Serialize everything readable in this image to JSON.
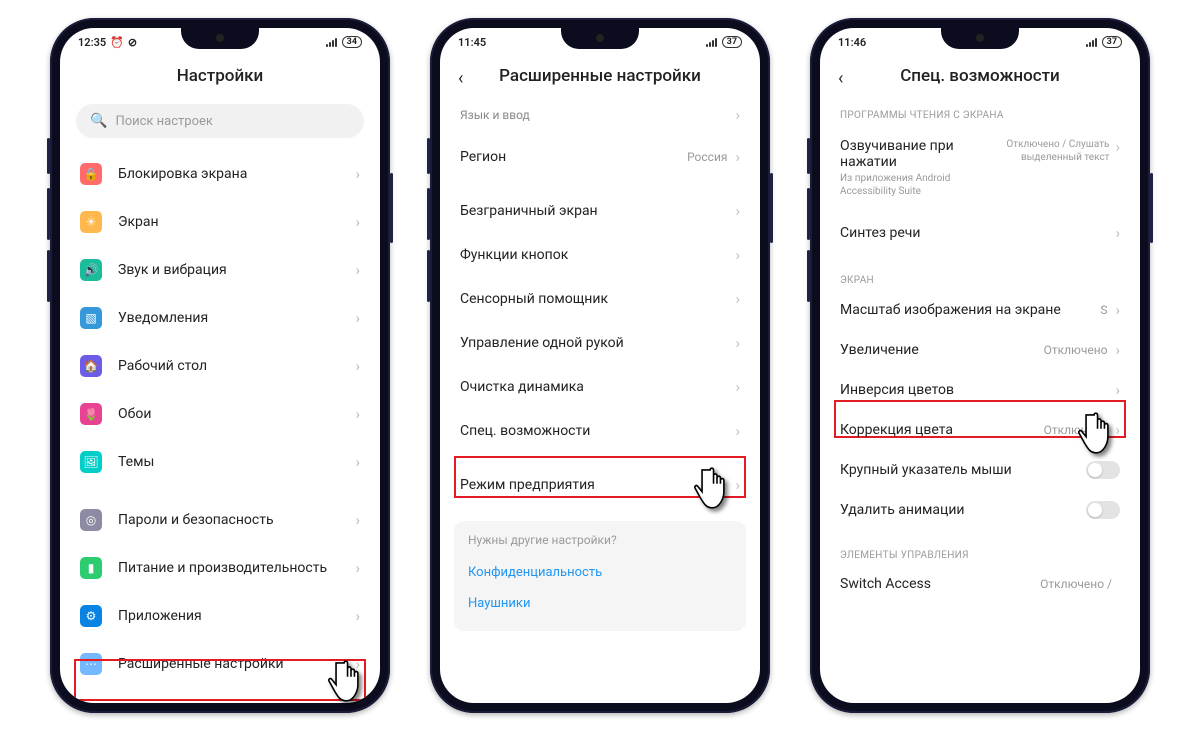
{
  "phone1": {
    "status": {
      "time": "12:35",
      "battery": "34"
    },
    "title": "Настройки",
    "search_placeholder": "Поиск настроек",
    "rows": [
      {
        "label": "Блокировка экрана"
      },
      {
        "label": "Экран"
      },
      {
        "label": "Звук и вибрация"
      },
      {
        "label": "Уведомления"
      },
      {
        "label": "Рабочий стол"
      },
      {
        "label": "Обои"
      },
      {
        "label": "Темы"
      }
    ],
    "rows2": [
      {
        "label": "Пароли и безопасность"
      },
      {
        "label": "Питание и производительность"
      },
      {
        "label": "Приложения"
      },
      {
        "label": "Расширенные настройки"
      }
    ]
  },
  "phone2": {
    "status": {
      "time": "11:45",
      "battery": "37"
    },
    "title": "Расширенные настройки",
    "top_row": "Язык и ввод",
    "region_label": "Регион",
    "region_value": "Россия",
    "rows": [
      "Безграничный экран",
      "Функции кнопок",
      "Сенсорный помощник",
      "Управление одной рукой",
      "Очистка динамика",
      "Спец. возможности"
    ],
    "enterprise": "Режим предприятия",
    "footer_q": "Нужны другие настройки?",
    "footer_links": [
      "Конфиденциальность",
      "Наушники"
    ]
  },
  "phone3": {
    "status": {
      "time": "11:46",
      "battery": "37"
    },
    "title": "Спец. возможности",
    "section_screenreader": "ПРОГРАММЫ ЧТЕНИЯ С ЭКРАНА",
    "talkback_label": "Озвучивание при нажатии",
    "talkback_sub": "Из приложения Android Accessibility Suite",
    "talkback_val1": "Отключено / Слушать",
    "talkback_val2": "выделенный текст",
    "tts": "Синтез речи",
    "section_display": "ЭКРАН",
    "rows_display": [
      {
        "label": "Масштаб изображения на экране",
        "val": "S"
      },
      {
        "label": "Увеличение",
        "val": "Отключено"
      },
      {
        "label": "Инверсия цветов",
        "val": ""
      },
      {
        "label": "Коррекция цвета",
        "val": "Отключено"
      }
    ],
    "toggle_rows": [
      "Крупный указатель мыши",
      "Удалить анимации"
    ],
    "section_controls": "ЭЛЕМЕНТЫ УПРАВЛЕНИЯ",
    "switch_access": "Switch Access",
    "switch_access_val": "Отключено /"
  }
}
